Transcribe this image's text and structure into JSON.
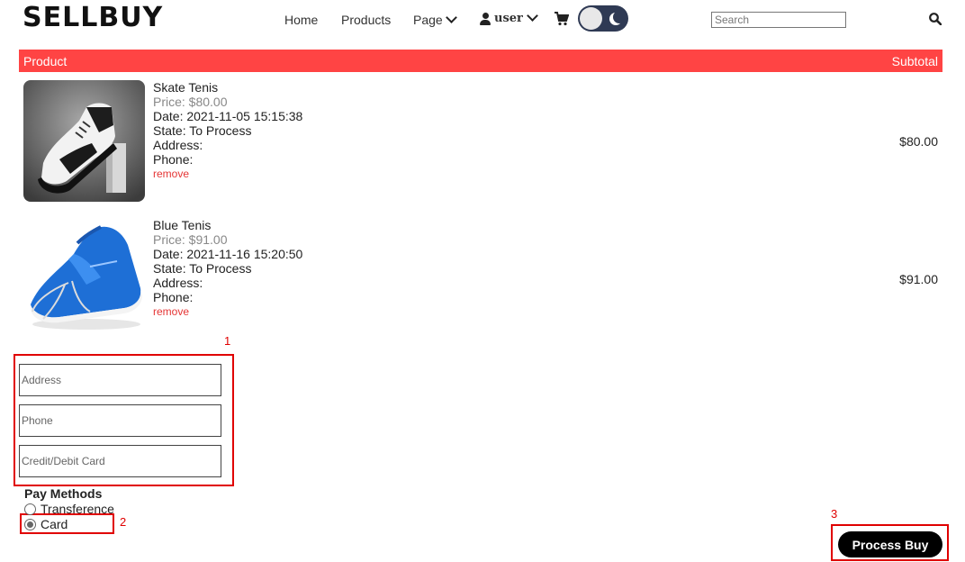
{
  "header": {
    "logo": "SELLBUY",
    "nav": {
      "home": "Home",
      "products": "Products",
      "page": "Page",
      "user": "user"
    },
    "search_placeholder": "Search",
    "theme_toggle_state": "dark"
  },
  "table": {
    "col_product": "Product",
    "col_subtotal": "Subtotal",
    "header_color": "#ff4444"
  },
  "items": [
    {
      "name": "Skate Tenis",
      "price": "Price: $80.00",
      "date": "Date: 2021-11-05 15:15:38",
      "state": "State: To Process",
      "address": "Address:",
      "phone": "Phone:",
      "remove": "remove",
      "subtotal": "$80.00"
    },
    {
      "name": "Blue Tenis",
      "price": "Price: $91.00",
      "date": "Date: 2021-11-16 15:20:50",
      "state": "State: To Process",
      "address": "Address:",
      "phone": "Phone:",
      "remove": "remove",
      "subtotal": "$91.00"
    }
  ],
  "form": {
    "address_placeholder": "Address",
    "phone_placeholder": "Phone",
    "card_placeholder": "Credit/Debit Card",
    "pay_methods_title": "Pay Methods",
    "options": [
      "Transference",
      "Card"
    ],
    "selected_option": "Card",
    "submit_label": "Process Buy"
  },
  "annotations": [
    "1",
    "2",
    "3"
  ],
  "colors": {
    "accent": "#ff4444",
    "annotation": "#e00000",
    "remove_link": "#e53535"
  }
}
